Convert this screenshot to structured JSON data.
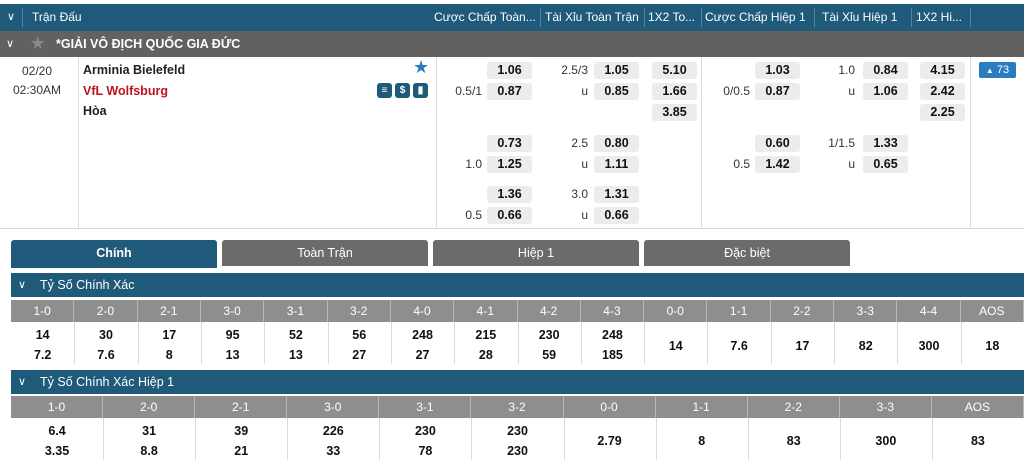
{
  "header": {
    "match_col": "Trận Đấu",
    "cols": [
      "Cược Chấp Toàn...",
      "Tài Xỉu Toàn Trận",
      "1X2 To...",
      "Cược Chấp Hiệp 1",
      "Tài Xỉu Hiệp 1",
      "1X2 Hi..."
    ]
  },
  "league": {
    "name": "*GIẢI VÔ ĐỊCH QUỐC GIA ĐỨC"
  },
  "match": {
    "date": "02/20",
    "time": "02:30AM",
    "home": "Arminia Bielefeld",
    "away": "VfL Wolfsburg",
    "draw": "Hòa",
    "more_count": "73",
    "colors": {
      "away_team": "#c0101e",
      "accent": "#1f5a7a",
      "star": "#2a7cc1"
    }
  },
  "odds_lines": [
    {
      "ah_hc": "0.5/1",
      "ah_home": "1.06",
      "ah_away": "0.87",
      "ou_line": "2.5/3",
      "ou_u": "u",
      "ou_over": "1.05",
      "ou_under": "0.85",
      "x_1": "5.10",
      "x_2": "1.66",
      "x_d": "3.85",
      "h1_hc": "0/0.5",
      "h1_home": "1.03",
      "h1_away": "0.87",
      "h1ou_line": "1.0",
      "h1ou_u": "u",
      "h1ou_over": "0.84",
      "h1ou_under": "1.06",
      "h1x_1": "4.15",
      "h1x_2": "2.42",
      "h1x_d": "2.25"
    },
    {
      "ah_hc": "1.0",
      "ah_home": "0.73",
      "ah_away": "1.25",
      "ou_line": "2.5",
      "ou_u": "u",
      "ou_over": "0.80",
      "ou_under": "1.11",
      "h1_hc": "0.5",
      "h1_home": "0.60",
      "h1_away": "1.42",
      "h1ou_line": "1/1.5",
      "h1ou_u": "u",
      "h1ou_over": "1.33",
      "h1ou_under": "0.65"
    },
    {
      "ah_hc": "0.5",
      "ah_home": "1.36",
      "ah_away": "0.66",
      "ou_line": "3.0",
      "ou_u": "u",
      "ou_over": "1.31",
      "ou_under": "0.66"
    }
  ],
  "tabs": [
    "Chính",
    "Toàn Trận",
    "Hiệp 1",
    "Đặc biệt"
  ],
  "correct_score": {
    "title": "Tỷ Số Chính Xác",
    "headers": [
      "1-0",
      "2-0",
      "2-1",
      "3-0",
      "3-1",
      "3-2",
      "4-0",
      "4-1",
      "4-2",
      "4-3",
      "0-0",
      "1-1",
      "2-2",
      "3-3",
      "4-4",
      "AOS"
    ],
    "row1": [
      "14",
      "30",
      "17",
      "95",
      "52",
      "56",
      "248",
      "215",
      "230",
      "248"
    ],
    "row2": [
      "7.2",
      "7.6",
      "8",
      "13",
      "13",
      "27",
      "27",
      "28",
      "59",
      "185"
    ],
    "single": [
      "14",
      "7.6",
      "17",
      "82",
      "300",
      "18"
    ]
  },
  "correct_score_h1": {
    "title": "Tỷ Số Chính Xác Hiệp 1",
    "headers": [
      "1-0",
      "2-0",
      "2-1",
      "3-0",
      "3-1",
      "3-2",
      "0-0",
      "1-1",
      "2-2",
      "3-3",
      "AOS"
    ],
    "row1": [
      "6.4",
      "31",
      "39",
      "226",
      "230",
      "230"
    ],
    "row2": [
      "3.35",
      "8.8",
      "21",
      "33",
      "78",
      "230"
    ],
    "single": [
      "2.79",
      "8",
      "83",
      "300",
      "83"
    ]
  }
}
